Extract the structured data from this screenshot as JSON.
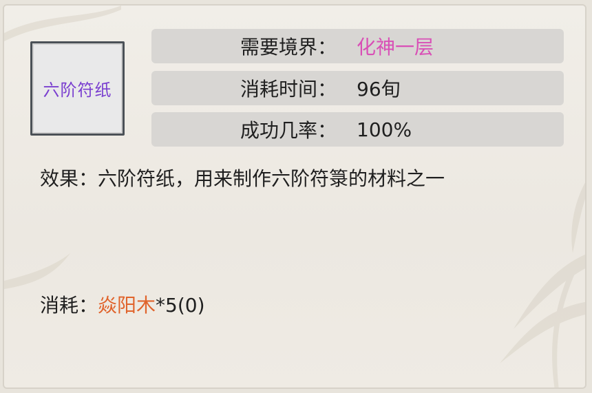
{
  "item": {
    "name": "六阶符纸",
    "name_color": "#7a3fd0"
  },
  "requirements": [
    {
      "label": "需要境界：",
      "value": "化神一层",
      "value_color": "#d94fb6"
    },
    {
      "label": "消耗时间：",
      "value": "96旬"
    },
    {
      "label": "成功几率：",
      "value": "100%"
    }
  ],
  "effect": {
    "label": "效果：",
    "text": "六阶符纸，用来制作六阶符箓的材料之一"
  },
  "cost": {
    "label": "消耗：",
    "material": "焱阳木",
    "material_color": "#e0632b",
    "amount": "*5(0)"
  },
  "icons": [
    "bamboo-leaf-decoration"
  ]
}
